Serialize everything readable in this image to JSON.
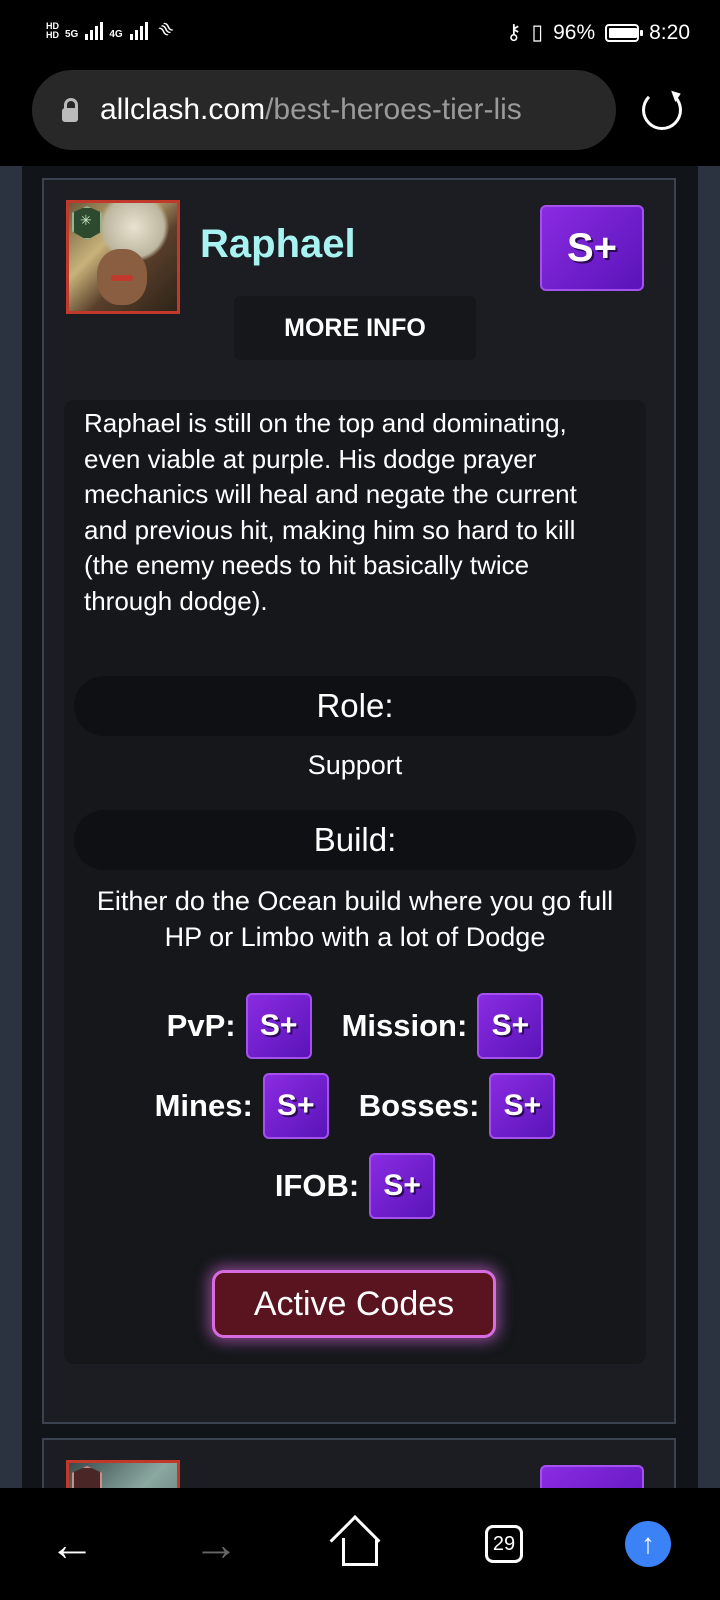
{
  "status_bar": {
    "network_1": "5G",
    "network_2": "4G",
    "battery": "96%",
    "time": "8:20"
  },
  "browser": {
    "url_domain": "allclash.com",
    "url_path": "/best-heroes-tier-lis",
    "tab_count": "29"
  },
  "hero": {
    "name": "Raphael",
    "tier": "S+",
    "more_info": "MORE INFO",
    "description": "Raphael is still on the top and dominating, even viable at purple. His dodge prayer mechanics will heal and negate the current and previous hit, making him so hard to kill (the enemy needs to hit basically twice through dodge).",
    "role_label": "Role:",
    "role": "Support",
    "build_label": "Build:",
    "build": "Either do the Ocean build where you go full HP or Limbo with a lot of Dodge",
    "ratings": [
      {
        "label": "PvP:",
        "tier": "S+"
      },
      {
        "label": "Mission:",
        "tier": "S+"
      },
      {
        "label": "Mines:",
        "tier": "S+"
      },
      {
        "label": "Bosses:",
        "tier": "S+"
      },
      {
        "label": "IFOB:",
        "tier": "S+"
      }
    ],
    "codes_button": "Active Codes"
  },
  "colors": {
    "hero_name": "#a9f2f2",
    "tier_badge": "#8a2be2",
    "codes_button_bg": "#5a1420",
    "codes_button_glow": "#d86be0"
  }
}
